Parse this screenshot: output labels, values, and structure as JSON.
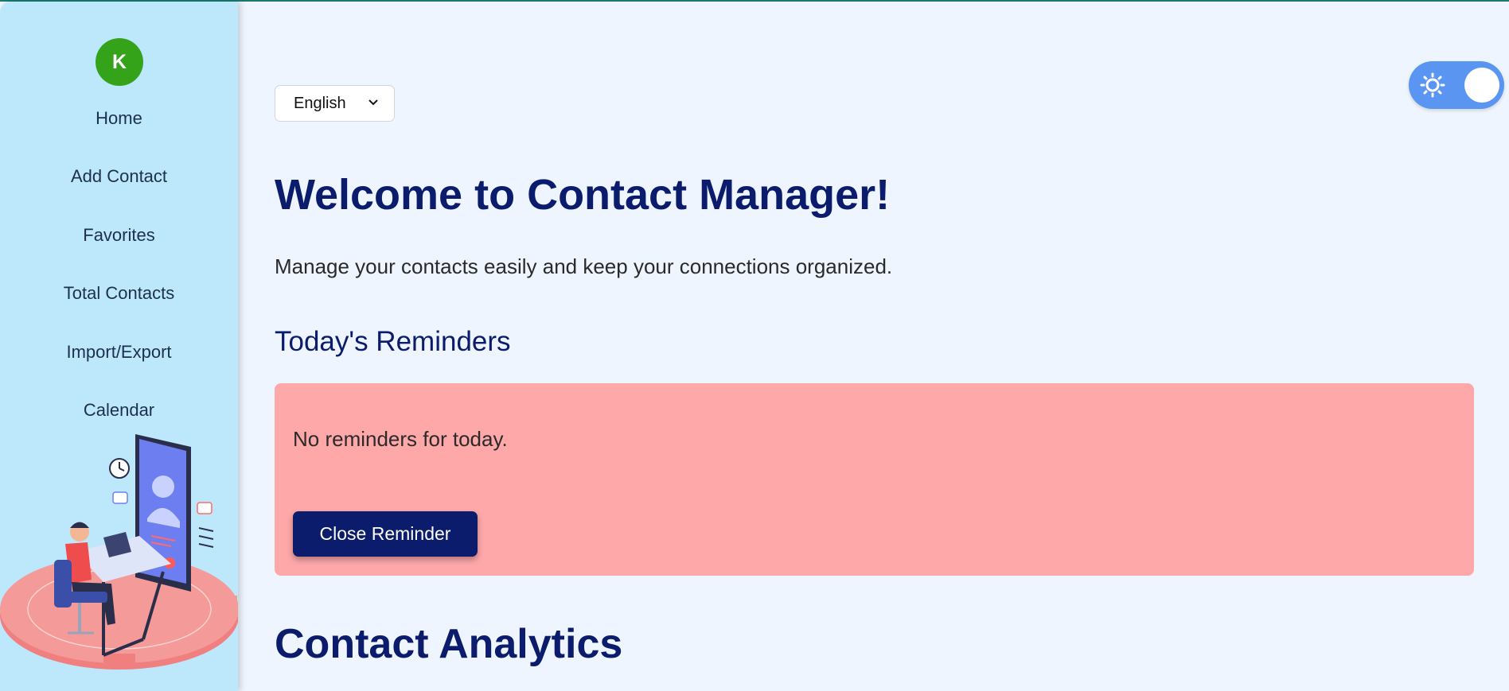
{
  "sidebar": {
    "avatar_initial": "K",
    "items": [
      {
        "label": "Home"
      },
      {
        "label": "Add Contact"
      },
      {
        "label": "Favorites"
      },
      {
        "label": "Total Contacts"
      },
      {
        "label": "Import/Export"
      },
      {
        "label": "Calendar"
      }
    ]
  },
  "language": {
    "selected": "English"
  },
  "theme_toggle": {
    "icon": "sun-icon",
    "state": "light"
  },
  "main": {
    "title": "Welcome to Contact Manager!",
    "subtitle": "Manage your contacts easily and keep your connections organized.",
    "reminders_heading": "Today's Reminders",
    "reminder_message": "No reminders for today.",
    "close_reminder_label": "Close Reminder",
    "analytics_heading": "Contact Analytics"
  },
  "colors": {
    "sidebar_bg": "#bde8fb",
    "avatar_bg": "#35a31a",
    "heading": "#0a1c6b",
    "reminder_bg": "#fea8aa",
    "toggle_bg": "#5b95f2",
    "page_bg": "#eff5fe"
  }
}
